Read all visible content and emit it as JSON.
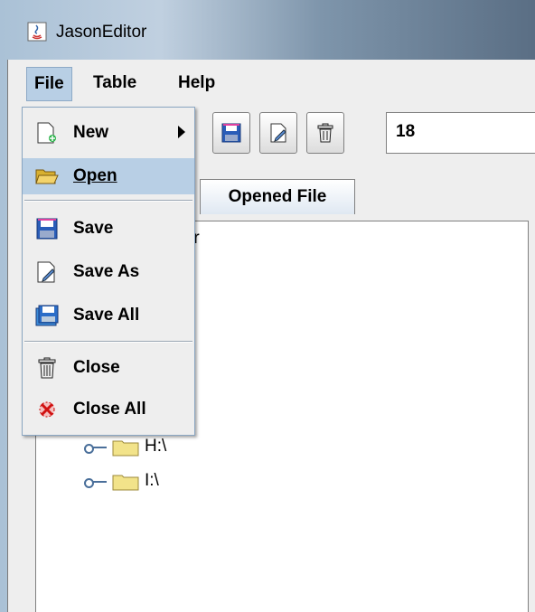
{
  "window": {
    "title": "JasonEditor"
  },
  "menubar": {
    "items": [
      {
        "label": "File",
        "active": true
      },
      {
        "label": "Table"
      },
      {
        "label": "Help"
      }
    ]
  },
  "toolbar": {
    "buttons": [
      "save-icon",
      "save-as-icon",
      "trash-icon"
    ],
    "number_field_value": "18"
  },
  "tabs": [
    {
      "label": "Opened File"
    }
  ],
  "tree": {
    "root_label_partial": "uter",
    "items": [
      {
        "label": "H:\\"
      },
      {
        "label": "I:\\"
      }
    ]
  },
  "file_menu": {
    "items": [
      {
        "label": "New",
        "icon": "new-file-icon",
        "submenu": true
      },
      {
        "label": "Open",
        "icon": "open-folder-icon",
        "selected": true
      },
      {
        "label": "Save",
        "icon": "save-icon"
      },
      {
        "label": "Save As",
        "icon": "save-as-icon"
      },
      {
        "label": "Save All",
        "icon": "save-all-icon"
      },
      {
        "label": "Close",
        "icon": "trash-icon"
      },
      {
        "label": "Close All",
        "icon": "close-all-icon"
      }
    ]
  },
  "colors": {
    "menu_highlight": "#b8cfe5",
    "folder": "#f2e38a",
    "tree_connector": "#4a6f9a"
  }
}
